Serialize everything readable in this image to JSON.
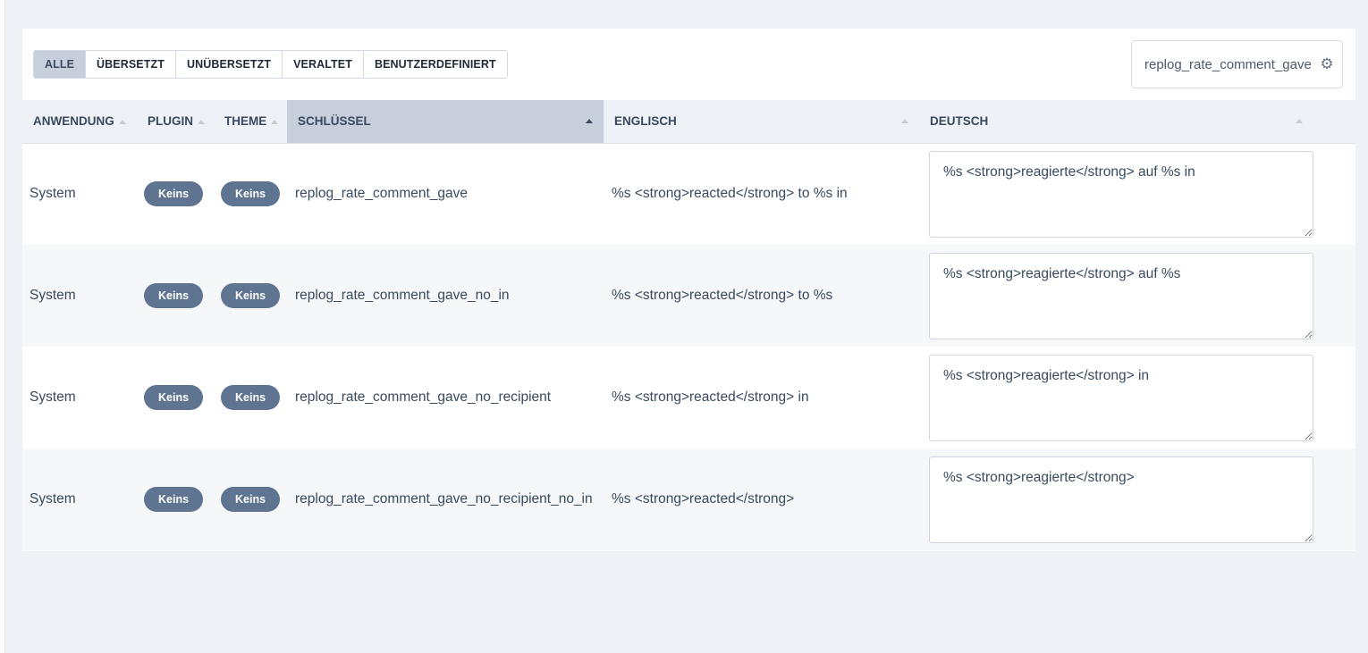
{
  "filters": [
    {
      "label": "ALLE",
      "active": true
    },
    {
      "label": "ÜBERSETZT",
      "active": false
    },
    {
      "label": "UNÜBERSETZT",
      "active": false
    },
    {
      "label": "VERALTET",
      "active": false
    },
    {
      "label": "BENUTZERDEFINIERT",
      "active": false
    }
  ],
  "search": {
    "value": "replog_rate_comment_gave",
    "icon": "gear-icon"
  },
  "columns": {
    "app": "ANWENDUNG",
    "plugin": "PLUGIN",
    "theme": "THEME",
    "key": "SCHLÜSSEL",
    "english": "ENGLISCH",
    "german": "DEUTSCH"
  },
  "rows": [
    {
      "app": "System",
      "plugin": "Keins",
      "theme": "Keins",
      "key": "replog_rate_comment_gave",
      "english": "%s <strong>reacted</strong> to %s in",
      "german": "%s <strong>reagierte</strong> auf %s in"
    },
    {
      "app": "System",
      "plugin": "Keins",
      "theme": "Keins",
      "key": "replog_rate_comment_gave_no_in",
      "english": "%s <strong>reacted</strong> to %s",
      "german": "%s <strong>reagierte</strong> auf %s"
    },
    {
      "app": "System",
      "plugin": "Keins",
      "theme": "Keins",
      "key": "replog_rate_comment_gave_no_recipient",
      "english": "%s <strong>reacted</strong> in",
      "german": "%s <strong>reagierte</strong> in"
    },
    {
      "app": "System",
      "plugin": "Keins",
      "theme": "Keins",
      "key": "replog_rate_comment_gave_no_recipient_no_in",
      "english": "%s <strong>reacted</strong>",
      "german": "%s <strong>reagierte</strong>"
    }
  ],
  "colors": {
    "badge": "#5e7491",
    "active_filter": "#c8cfdc",
    "page_bg": "#eef1f6"
  }
}
